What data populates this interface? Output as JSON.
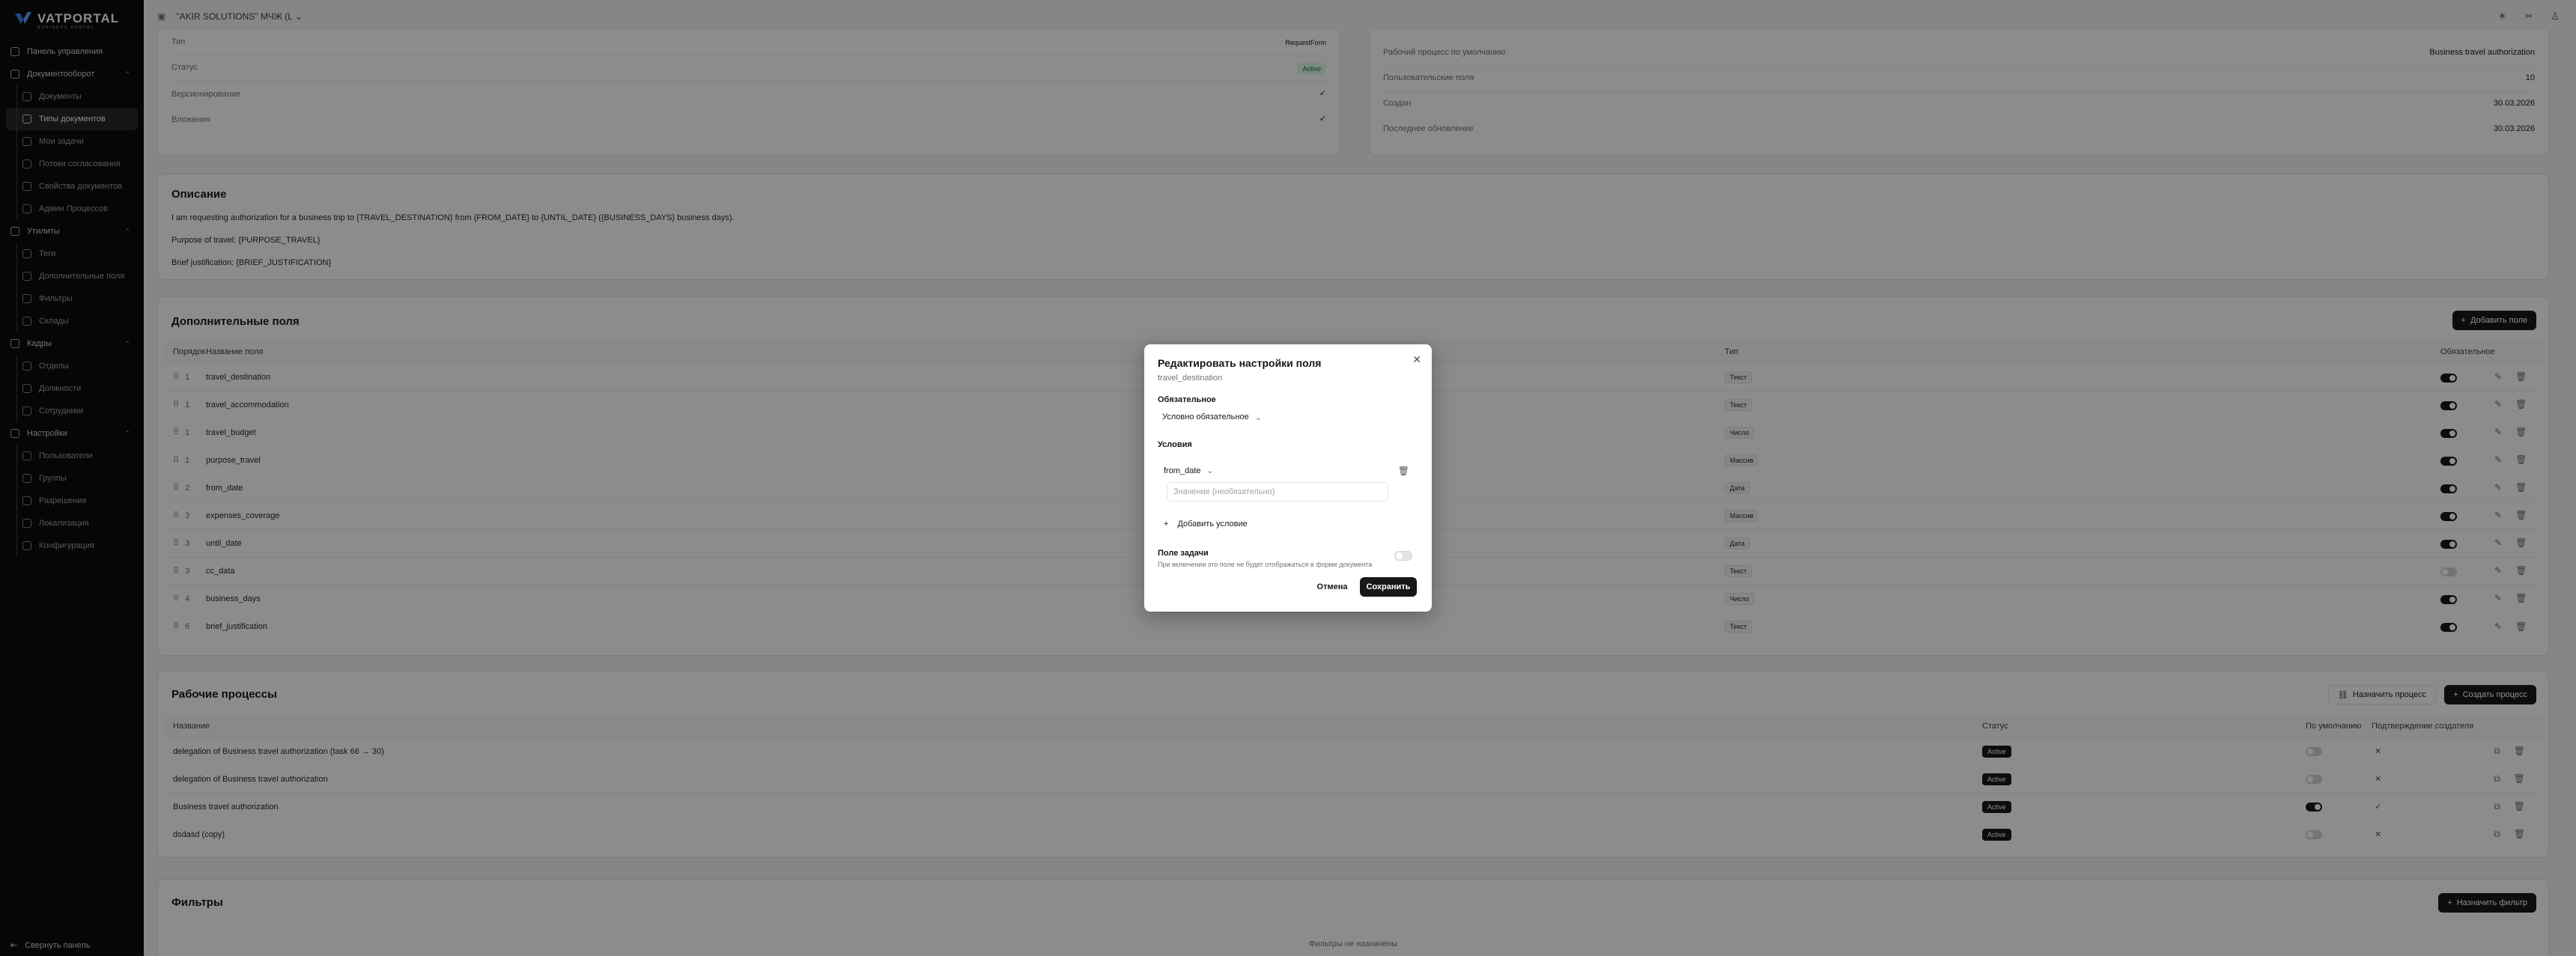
{
  "sidebar": {
    "brand": "VATPORTAL",
    "brand_sub": "BUSINESS PORTAL",
    "items": [
      {
        "label": "Панель управления",
        "level": 0
      },
      {
        "label": "Документооборот",
        "level": 0,
        "expandable": true
      },
      {
        "label": "Документы",
        "level": 1
      },
      {
        "label": "Типы документов",
        "level": 1,
        "active": true
      },
      {
        "label": "Мои задачи",
        "level": 1
      },
      {
        "label": "Потоки согласования",
        "level": 1
      },
      {
        "label": "Свойства документов",
        "level": 1
      },
      {
        "label": "Админ Процессов",
        "level": 1
      },
      {
        "label": "Утилиты",
        "level": 0,
        "expandable": true
      },
      {
        "label": "Теги",
        "level": 1
      },
      {
        "label": "Дополнительные поля",
        "level": 1
      },
      {
        "label": "Фильтры",
        "level": 1
      },
      {
        "label": "Склады",
        "level": 1
      },
      {
        "label": "Кадры",
        "level": 0,
        "expandable": true
      },
      {
        "label": "Отделы",
        "level": 1
      },
      {
        "label": "Должности",
        "level": 1
      },
      {
        "label": "Сотрудники",
        "level": 1
      },
      {
        "label": "Настройки",
        "level": 0,
        "expandable": true
      },
      {
        "label": "Пользователи",
        "level": 1
      },
      {
        "label": "Группы",
        "level": 1
      },
      {
        "label": "Разрешения",
        "level": 1
      },
      {
        "label": "Локализация",
        "level": 1
      },
      {
        "label": "Конфигурация",
        "level": 1
      }
    ],
    "collapse_label": "Свернуть панель"
  },
  "topbar": {
    "company": "\"AKIR SOLUTIONS\" MЧЖ (L"
  },
  "info_left": {
    "rows": [
      {
        "label": "Тип",
        "value": "RequestForm"
      },
      {
        "label": "Статус",
        "value": "Active"
      },
      {
        "label": "Версионирование",
        "value": "✓"
      },
      {
        "label": "Вложения",
        "value": "✓"
      }
    ]
  },
  "info_right": {
    "rows": [
      {
        "label": "Рабочий процесс по умолчанию",
        "value": "Business travel authorization"
      },
      {
        "label": "Пользовательские поля",
        "value": "10"
      },
      {
        "label": "Создан",
        "value": "30.03.2026"
      },
      {
        "label": "Последнее обновление",
        "value": "30.03.2026"
      }
    ]
  },
  "description": {
    "title": "Описание",
    "lines": [
      "I am requesting authorization for a business trip to {TRAVEL_DESTINATION} from {FROM_DATE} to {UNTIL_DATE} ({BUSINESS_DAYS} business days).",
      "Purpose of travel: {PURPOSE_TRAVEL}",
      "Brief justification: {BRIEF_JUSTIFICATION}"
    ]
  },
  "extra_fields": {
    "title": "Дополнительные поля",
    "add_button": "Добавить поле",
    "headers": {
      "order": "Порядок",
      "name": "Название поля",
      "type": "Тип",
      "required": "Обязательное"
    },
    "rows": [
      {
        "order": "1",
        "name": "travel_destination",
        "type": "Текст",
        "required": true
      },
      {
        "order": "1",
        "name": "travel_accommodation",
        "type": "Текст",
        "required": true
      },
      {
        "order": "1",
        "name": "travel_budget",
        "type": "Число",
        "required": true
      },
      {
        "order": "1",
        "name": "purpose_travel",
        "type": "Массив",
        "required": true
      },
      {
        "order": "2",
        "name": "from_date",
        "type": "Дата",
        "required": true
      },
      {
        "order": "3",
        "name": "expenses_coverage",
        "type": "Массив",
        "required": true
      },
      {
        "order": "3",
        "name": "until_date",
        "type": "Дата",
        "required": true
      },
      {
        "order": "3",
        "name": "cc_data",
        "type": "Текст",
        "required": false
      },
      {
        "order": "4",
        "name": "business_days",
        "type": "Число",
        "required": true
      },
      {
        "order": "6",
        "name": "brief_justification",
        "type": "Текст",
        "required": true
      }
    ]
  },
  "workflows": {
    "title": "Рабочие процессы",
    "assign_button": "Назначить процесс",
    "create_button": "Создать процесс",
    "headers": {
      "name": "Название",
      "status": "Статус",
      "default": "По умолчанию",
      "creator_confirm": "Подтверждение создателя"
    },
    "rows": [
      {
        "name": "delegation of Business travel authorization (task 66 → 30)",
        "status": "Active",
        "default": false,
        "confirm": "✕"
      },
      {
        "name": "delegation of Business travel authorization",
        "status": "Active",
        "default": false,
        "confirm": "✕"
      },
      {
        "name": "Business travel authorization",
        "status": "Active",
        "default": true,
        "confirm": "✓"
      },
      {
        "name": "dsdasd (copy)",
        "status": "Active",
        "default": false,
        "confirm": "✕"
      }
    ]
  },
  "filters": {
    "title": "Фильтры",
    "assign_button": "Назначить фильтр",
    "empty": "Фильтры не назначены"
  },
  "modal": {
    "title": "Редактировать настройки поля",
    "subtitle": "travel_destination",
    "required_label": "Обязательное",
    "required_value": "Условно обязательное",
    "conditions_label": "Условия",
    "condition_field": "from_date",
    "value_placeholder": "Значение (необязательно)",
    "add_condition": "Добавить условие",
    "task_field_label": "Поле задачи",
    "task_field_hint": "При включении это поле не будет отображаться в форме документа",
    "cancel": "Отмена",
    "save": "Сохранить"
  }
}
